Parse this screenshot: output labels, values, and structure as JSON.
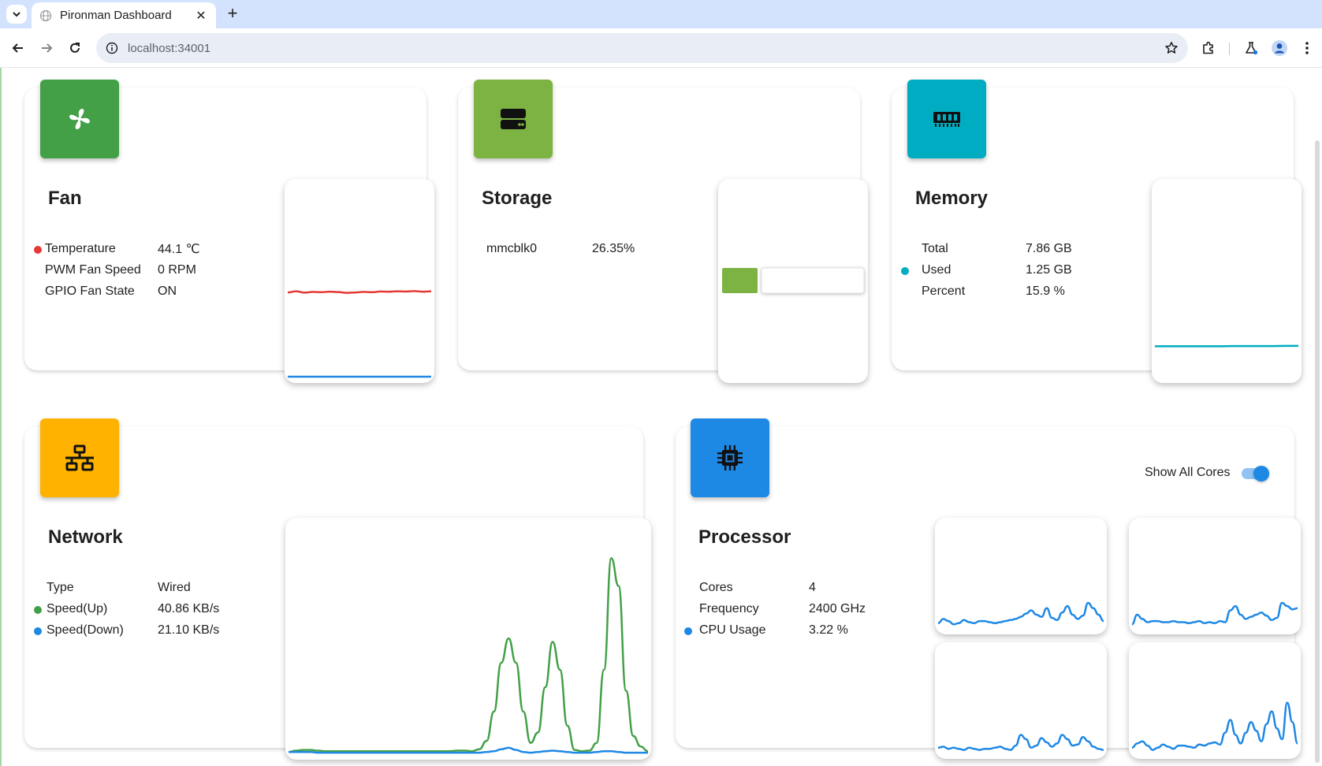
{
  "browser": {
    "tab_title": "Pironman Dashboard",
    "tab_close": "✕",
    "new_tab": "+",
    "url": "localhost:34001"
  },
  "fan": {
    "title": "Fan",
    "icon": "fan-icon",
    "color": "#43a047",
    "rows": [
      {
        "label": "Temperature",
        "value": "44.1 ℃",
        "dot": "#e53935"
      },
      {
        "label": "PWM Fan Speed",
        "value": "0 RPM"
      },
      {
        "label": "GPIO Fan State",
        "value": "ON"
      }
    ]
  },
  "storage": {
    "title": "Storage",
    "icon": "storage-icon",
    "color": "#7cb342",
    "rows": [
      {
        "label": "mmcblk0",
        "value": "26.35%"
      }
    ],
    "usage_fraction": 0.2635
  },
  "memory": {
    "title": "Memory",
    "icon": "memory-icon",
    "color": "#00acc1",
    "rows": [
      {
        "label": "Total",
        "value": "7.86 GB"
      },
      {
        "label": "Used",
        "value": "1.25 GB",
        "dot": "#00acc1"
      },
      {
        "label": "Percent",
        "value": "15.9 %"
      }
    ]
  },
  "network": {
    "title": "Network",
    "icon": "network-icon",
    "color": "#ffb300",
    "rows": [
      {
        "label": "Type",
        "value": "Wired"
      },
      {
        "label": "Speed(Up)",
        "value": "40.86 KB/s",
        "dot": "#43a047"
      },
      {
        "label": "Speed(Down)",
        "value": "21.10 KB/s",
        "dot": "#1e88e5"
      }
    ]
  },
  "processor": {
    "title": "Processor",
    "icon": "cpu-icon",
    "color": "#1e88e5",
    "toggle_label": "Show All Cores",
    "toggle_on": true,
    "rows": [
      {
        "label": "Cores",
        "value": "4"
      },
      {
        "label": "Frequency",
        "value": "2400 GHz"
      },
      {
        "label": "CPU Usage",
        "value": "3.22 %",
        "dot": "#1e88e5"
      }
    ]
  },
  "chart_data": [
    {
      "type": "line",
      "name": "fan-history",
      "ylim": [
        0,
        100
      ],
      "series": [
        {
          "color": "#e53935",
          "values": [
            44.0,
            44.6,
            43.9,
            44.3,
            44.1,
            44.4,
            44.2,
            43.8,
            44.0,
            44.3,
            44.1,
            44.5,
            44.4,
            44.6,
            44.5,
            44.7,
            44.4,
            44.6
          ]
        },
        {
          "color": "#1e88e5",
          "values": [
            0,
            0,
            0,
            0,
            0,
            0,
            0,
            0,
            0,
            0,
            0,
            0,
            0,
            0,
            0,
            0,
            0,
            0
          ]
        }
      ]
    },
    {
      "type": "line",
      "name": "memory-history",
      "ylim": [
        0,
        100
      ],
      "series": [
        {
          "color": "#00acc1",
          "values": [
            15.9,
            15.9,
            15.9,
            15.9,
            15.9,
            15.9,
            16.0,
            16.0,
            16.0,
            16.0,
            16.1,
            16.1
          ]
        }
      ]
    },
    {
      "type": "line",
      "name": "network-history",
      "ylim": [
        0,
        320
      ],
      "series": [
        {
          "color": "#43a047",
          "values": [
            2,
            4,
            5,
            5,
            4,
            3,
            3,
            3,
            3,
            3,
            3,
            3,
            3,
            3,
            3,
            3,
            3,
            3,
            3,
            3,
            3,
            3,
            3,
            4,
            4,
            3,
            6,
            18,
            60,
            130,
            165,
            130,
            60,
            15,
            30,
            95,
            160,
            120,
            40,
            5,
            3,
            4,
            15,
            120,
            280,
            240,
            90,
            25,
            10,
            3
          ]
        },
        {
          "color": "#1e88e5",
          "values": [
            2,
            2,
            2,
            2,
            1,
            1,
            1,
            1,
            1,
            1,
            1,
            1,
            1,
            1,
            1,
            1,
            1,
            1,
            1,
            1,
            1,
            1,
            1,
            1,
            1,
            1,
            1,
            2,
            3,
            6,
            8,
            5,
            2,
            1,
            2,
            3,
            4,
            3,
            2,
            1,
            1,
            1,
            2,
            3,
            3,
            2,
            1,
            1,
            1,
            1
          ]
        }
      ]
    },
    {
      "type": "line",
      "name": "core-0-history",
      "ylim": [
        0,
        100
      ],
      "series": [
        {
          "color": "#1e88e5",
          "values": [
            6,
            10,
            8,
            5,
            6,
            9,
            7,
            6,
            8,
            8,
            7,
            6,
            7,
            8,
            9,
            10,
            12,
            15,
            18,
            14,
            12,
            20,
            11,
            9,
            16,
            22,
            14,
            10,
            13,
            25,
            20,
            14,
            8
          ]
        }
      ]
    },
    {
      "type": "line",
      "name": "core-1-history",
      "ylim": [
        0,
        100
      ],
      "series": [
        {
          "color": "#1e88e5",
          "values": [
            5,
            14,
            10,
            7,
            8,
            8,
            7,
            7,
            8,
            7,
            7,
            6,
            7,
            8,
            6,
            7,
            6,
            8,
            7,
            18,
            22,
            14,
            10,
            12,
            14,
            16,
            13,
            9,
            11,
            25,
            22,
            19,
            20
          ]
        }
      ]
    },
    {
      "type": "line",
      "name": "core-2-history",
      "ylim": [
        0,
        100
      ],
      "series": [
        {
          "color": "#1e88e5",
          "values": [
            6,
            7,
            5,
            6,
            5,
            4,
            6,
            5,
            4,
            5,
            5,
            6,
            7,
            5,
            4,
            8,
            18,
            14,
            6,
            8,
            15,
            11,
            7,
            10,
            18,
            14,
            8,
            9,
            16,
            12,
            7,
            5,
            4
          ]
        }
      ]
    },
    {
      "type": "line",
      "name": "core-3-history",
      "ylim": [
        0,
        100
      ],
      "series": [
        {
          "color": "#1e88e5",
          "values": [
            6,
            10,
            12,
            8,
            4,
            6,
            9,
            7,
            5,
            8,
            8,
            7,
            6,
            9,
            8,
            10,
            11,
            9,
            20,
            32,
            18,
            10,
            20,
            30,
            22,
            12,
            28,
            40,
            24,
            14,
            48,
            30,
            10
          ]
        }
      ]
    }
  ]
}
